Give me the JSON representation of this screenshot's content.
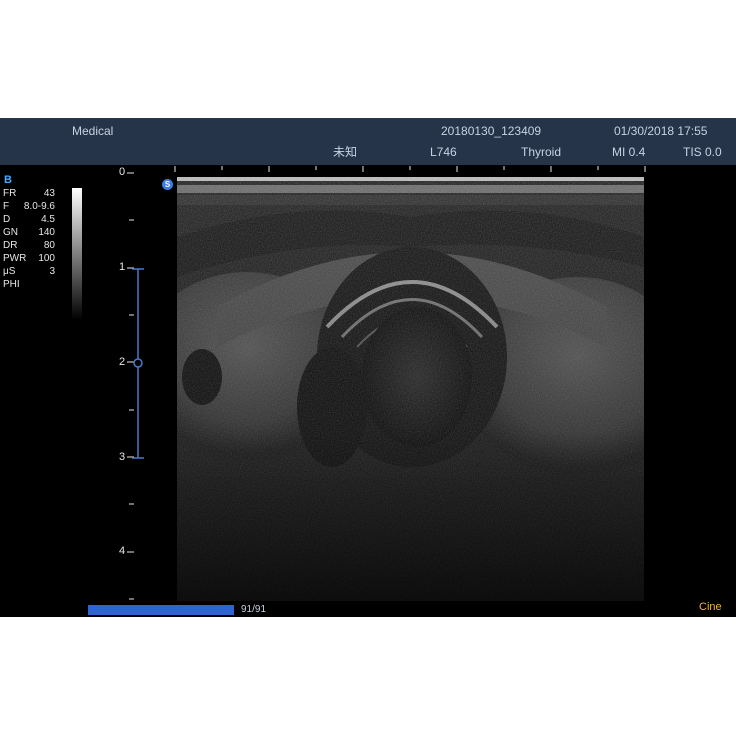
{
  "header": {
    "institution": "Medical",
    "exam_id": "20180130_123409",
    "datetime": "01/30/2018 17:55",
    "patient_name": "未知",
    "probe": "L746",
    "preset": "Thyroid",
    "mi": "MI 0.4",
    "tis": "TIS 0.0"
  },
  "params": {
    "mode": "B",
    "items": [
      {
        "label": "FR",
        "value": "43"
      },
      {
        "label": "F",
        "value": "8.0-9.6"
      },
      {
        "label": "D",
        "value": "4.5"
      },
      {
        "label": "GN",
        "value": "140"
      },
      {
        "label": "DR",
        "value": "80"
      },
      {
        "label": "PWR",
        "value": "100"
      },
      {
        "label": "μS",
        "value": "3"
      },
      {
        "label": "PHI",
        "value": ""
      }
    ]
  },
  "depth_scale": {
    "labels": [
      "0",
      "1",
      "2",
      "3",
      "4"
    ],
    "unit_max": 4.5
  },
  "cine": {
    "frames": "91/91",
    "label": "Cine",
    "progress": 1.0
  },
  "colors": {
    "header_bg": "#253449",
    "header_text": "#c7d2e2",
    "mode_text": "#4aa8ff",
    "focus_marker": "#4a78c8",
    "cine_bar": "#2e64d1",
    "cine_label": "#f0b23c"
  },
  "icons": {
    "orientation": "orientation-marker-icon"
  }
}
